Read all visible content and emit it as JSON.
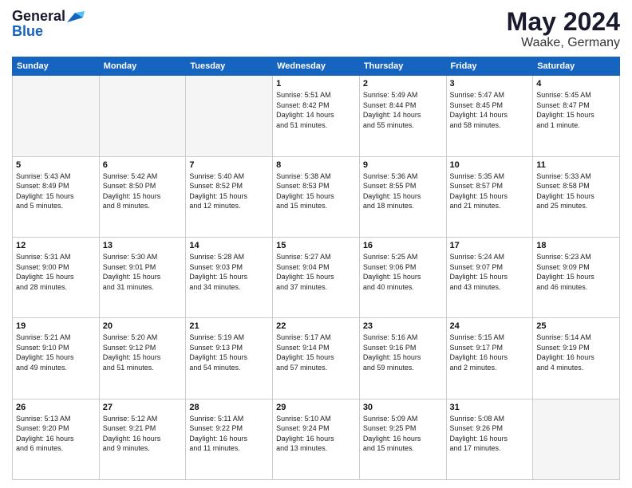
{
  "header": {
    "logo_general": "General",
    "logo_blue": "Blue",
    "title": "May 2024",
    "location": "Waake, Germany"
  },
  "weekdays": [
    "Sunday",
    "Monday",
    "Tuesday",
    "Wednesday",
    "Thursday",
    "Friday",
    "Saturday"
  ],
  "weeks": [
    [
      {
        "day": "",
        "info": ""
      },
      {
        "day": "",
        "info": ""
      },
      {
        "day": "",
        "info": ""
      },
      {
        "day": "1",
        "info": "Sunrise: 5:51 AM\nSunset: 8:42 PM\nDaylight: 14 hours\nand 51 minutes."
      },
      {
        "day": "2",
        "info": "Sunrise: 5:49 AM\nSunset: 8:44 PM\nDaylight: 14 hours\nand 55 minutes."
      },
      {
        "day": "3",
        "info": "Sunrise: 5:47 AM\nSunset: 8:45 PM\nDaylight: 14 hours\nand 58 minutes."
      },
      {
        "day": "4",
        "info": "Sunrise: 5:45 AM\nSunset: 8:47 PM\nDaylight: 15 hours\nand 1 minute."
      }
    ],
    [
      {
        "day": "5",
        "info": "Sunrise: 5:43 AM\nSunset: 8:49 PM\nDaylight: 15 hours\nand 5 minutes."
      },
      {
        "day": "6",
        "info": "Sunrise: 5:42 AM\nSunset: 8:50 PM\nDaylight: 15 hours\nand 8 minutes."
      },
      {
        "day": "7",
        "info": "Sunrise: 5:40 AM\nSunset: 8:52 PM\nDaylight: 15 hours\nand 12 minutes."
      },
      {
        "day": "8",
        "info": "Sunrise: 5:38 AM\nSunset: 8:53 PM\nDaylight: 15 hours\nand 15 minutes."
      },
      {
        "day": "9",
        "info": "Sunrise: 5:36 AM\nSunset: 8:55 PM\nDaylight: 15 hours\nand 18 minutes."
      },
      {
        "day": "10",
        "info": "Sunrise: 5:35 AM\nSunset: 8:57 PM\nDaylight: 15 hours\nand 21 minutes."
      },
      {
        "day": "11",
        "info": "Sunrise: 5:33 AM\nSunset: 8:58 PM\nDaylight: 15 hours\nand 25 minutes."
      }
    ],
    [
      {
        "day": "12",
        "info": "Sunrise: 5:31 AM\nSunset: 9:00 PM\nDaylight: 15 hours\nand 28 minutes."
      },
      {
        "day": "13",
        "info": "Sunrise: 5:30 AM\nSunset: 9:01 PM\nDaylight: 15 hours\nand 31 minutes."
      },
      {
        "day": "14",
        "info": "Sunrise: 5:28 AM\nSunset: 9:03 PM\nDaylight: 15 hours\nand 34 minutes."
      },
      {
        "day": "15",
        "info": "Sunrise: 5:27 AM\nSunset: 9:04 PM\nDaylight: 15 hours\nand 37 minutes."
      },
      {
        "day": "16",
        "info": "Sunrise: 5:25 AM\nSunset: 9:06 PM\nDaylight: 15 hours\nand 40 minutes."
      },
      {
        "day": "17",
        "info": "Sunrise: 5:24 AM\nSunset: 9:07 PM\nDaylight: 15 hours\nand 43 minutes."
      },
      {
        "day": "18",
        "info": "Sunrise: 5:23 AM\nSunset: 9:09 PM\nDaylight: 15 hours\nand 46 minutes."
      }
    ],
    [
      {
        "day": "19",
        "info": "Sunrise: 5:21 AM\nSunset: 9:10 PM\nDaylight: 15 hours\nand 49 minutes."
      },
      {
        "day": "20",
        "info": "Sunrise: 5:20 AM\nSunset: 9:12 PM\nDaylight: 15 hours\nand 51 minutes."
      },
      {
        "day": "21",
        "info": "Sunrise: 5:19 AM\nSunset: 9:13 PM\nDaylight: 15 hours\nand 54 minutes."
      },
      {
        "day": "22",
        "info": "Sunrise: 5:17 AM\nSunset: 9:14 PM\nDaylight: 15 hours\nand 57 minutes."
      },
      {
        "day": "23",
        "info": "Sunrise: 5:16 AM\nSunset: 9:16 PM\nDaylight: 15 hours\nand 59 minutes."
      },
      {
        "day": "24",
        "info": "Sunrise: 5:15 AM\nSunset: 9:17 PM\nDaylight: 16 hours\nand 2 minutes."
      },
      {
        "day": "25",
        "info": "Sunrise: 5:14 AM\nSunset: 9:19 PM\nDaylight: 16 hours\nand 4 minutes."
      }
    ],
    [
      {
        "day": "26",
        "info": "Sunrise: 5:13 AM\nSunset: 9:20 PM\nDaylight: 16 hours\nand 6 minutes."
      },
      {
        "day": "27",
        "info": "Sunrise: 5:12 AM\nSunset: 9:21 PM\nDaylight: 16 hours\nand 9 minutes."
      },
      {
        "day": "28",
        "info": "Sunrise: 5:11 AM\nSunset: 9:22 PM\nDaylight: 16 hours\nand 11 minutes."
      },
      {
        "day": "29",
        "info": "Sunrise: 5:10 AM\nSunset: 9:24 PM\nDaylight: 16 hours\nand 13 minutes."
      },
      {
        "day": "30",
        "info": "Sunrise: 5:09 AM\nSunset: 9:25 PM\nDaylight: 16 hours\nand 15 minutes."
      },
      {
        "day": "31",
        "info": "Sunrise: 5:08 AM\nSunset: 9:26 PM\nDaylight: 16 hours\nand 17 minutes."
      },
      {
        "day": "",
        "info": ""
      }
    ]
  ]
}
